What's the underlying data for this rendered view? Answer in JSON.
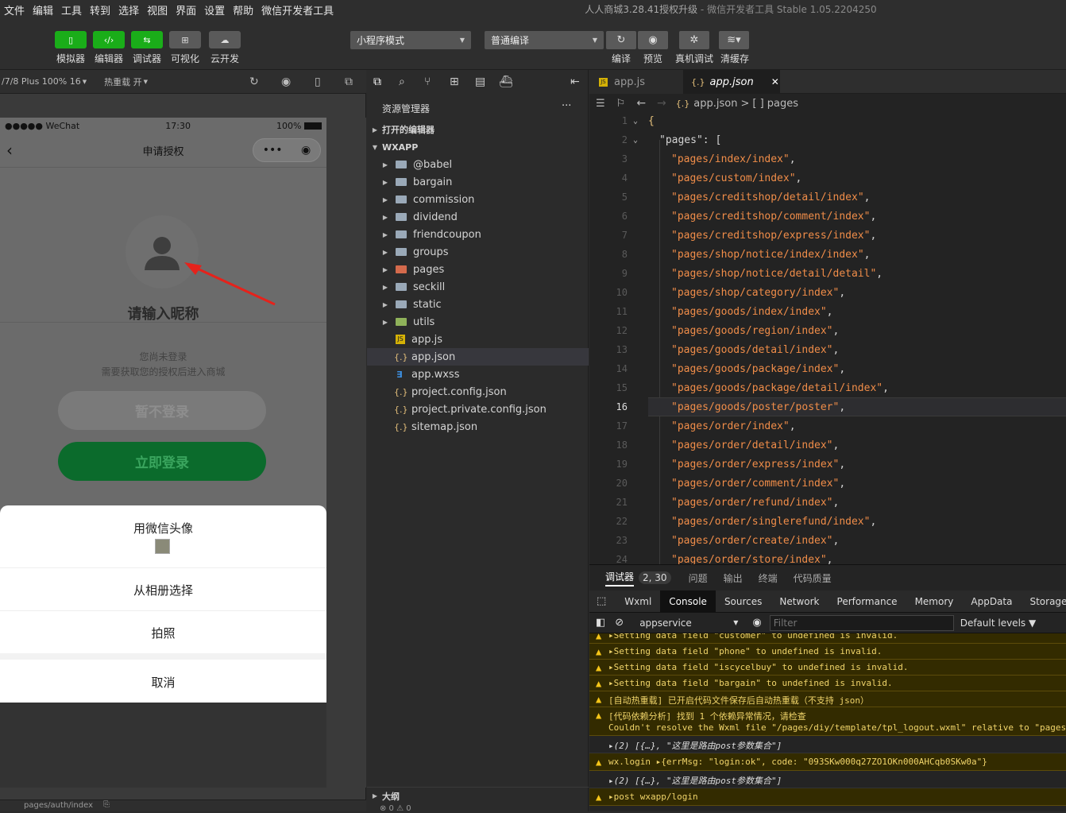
{
  "menu": [
    "文件",
    "编辑",
    "工具",
    "转到",
    "选择",
    "视图",
    "界面",
    "设置",
    "帮助",
    "微信开发者工具"
  ],
  "window_title": {
    "project": "人人商城3.28.41授权升级",
    "sep": " - ",
    "app": "微信开发者工具 Stable 1.05.2204250"
  },
  "toolbar": {
    "simulator": "模拟器",
    "editor": "编辑器",
    "debugger": "调试器",
    "visual": "可视化",
    "cloud": "云开发",
    "mode_select": "小程序模式",
    "compile_select": "普通编译",
    "compile": "编译",
    "preview": "预览",
    "remote_debug": "真机调试",
    "clear_cache": "清缓存"
  },
  "simbar": {
    "device": "/7/8 Plus 100% 16",
    "hot_reload": "热重载 开"
  },
  "phone": {
    "carrier": "●●●●● WeChat",
    "time": "17:30",
    "battery": "100%",
    "nav_title": "申请授权",
    "capsule_dots": "•••",
    "nickname_placeholder": "请输入昵称",
    "not_logged": "您尚未登录",
    "need_auth": "需要获取您的授权后进入商城",
    "skip_btn": "暂不登录",
    "login_btn": "立即登录"
  },
  "sheet": {
    "opt1": "用微信头像",
    "opt2": "从相册选择",
    "opt3": "拍照",
    "cancel": "取消"
  },
  "sim_footer": {
    "path": "pages/auth/index"
  },
  "explorer": {
    "title": "资源管理器",
    "more": "···",
    "open_editors": "打开的编辑器",
    "project": "WXAPP",
    "outline": "大纲",
    "folders": [
      "@babel",
      "bargain",
      "commission",
      "dividend",
      "friendcoupon",
      "groups",
      "pages",
      "seckill",
      "static",
      "utils"
    ],
    "files": [
      "app.js",
      "app.json",
      "app.wxss",
      "project.config.json",
      "project.private.config.json",
      "sitemap.json"
    ],
    "footer": "⊗ 0 ⚠ 0"
  },
  "editor": {
    "tab1": "app.js",
    "tab2": "app.json",
    "close": "✕",
    "breadcrumb_file": "app.json",
    "breadcrumb_sep": ">",
    "breadcrumb_node": "[ ] pages",
    "line1": "{",
    "line2_key": "\"pages\"",
    "line2_rest": ": [",
    "pages": [
      "pages/index/index",
      "pages/custom/index",
      "pages/creditshop/detail/index",
      "pages/creditshop/comment/index",
      "pages/creditshop/express/index",
      "pages/shop/notice/index/index",
      "pages/shop/notice/detail/detail",
      "pages/shop/category/index",
      "pages/goods/index/index",
      "pages/goods/region/index",
      "pages/goods/detail/index",
      "pages/goods/package/index",
      "pages/goods/package/detail/index",
      "pages/goods/poster/poster",
      "pages/order/index",
      "pages/order/detail/index",
      "pages/order/express/index",
      "pages/order/comment/index",
      "pages/order/refund/index",
      "pages/order/singlerefund/index",
      "pages/order/create/index",
      "pages/order/store/index"
    ],
    "line_numbers": [
      "1",
      "2",
      "3",
      "4",
      "5",
      "6",
      "7",
      "8",
      "9",
      "10",
      "11",
      "12",
      "13",
      "14",
      "15",
      "16",
      "17",
      "18",
      "19",
      "20",
      "21",
      "22",
      "23",
      "24"
    ]
  },
  "devtools": {
    "panel_tabs": [
      "调试器",
      "问题",
      "输出",
      "终端",
      "代码质量"
    ],
    "badge": "2, 30",
    "tabs": [
      "Wxml",
      "Console",
      "Sources",
      "Network",
      "Performance",
      "Memory",
      "AppData",
      "Storage"
    ],
    "context": "appservice",
    "filter": "Filter",
    "levels": "Default levels ▼",
    "logs": [
      "▸Setting data field \"customer\" to undefined is invalid.",
      "▸Setting data field \"phone\" to undefined is invalid.",
      "▸Setting data field \"iscycelbuy\" to undefined is invalid.",
      "▸Setting data field \"bargain\" to undefined is invalid.",
      "[自动热重载] 已开启代码文件保存后自动热重载（不支持 json）",
      "[代码依赖分析] 找到 1 个依赖异常情况，请检查",
      "Couldn't resolve the Wxml file \"/pages/diy/template/tpl_logout.wxml\" relative to \"pages/",
      "▸(2) [{…}, \"这里是路由post参数集合\"]",
      "wx.login ▸{errMsg: \"login:ok\", code: \"093SKw000q27ZO1OKn000AHCqb0SKw0a\"}",
      "▸(2) [{…}, \"这里是路由post参数集合\"]",
      "▸post wxapp/login"
    ]
  }
}
